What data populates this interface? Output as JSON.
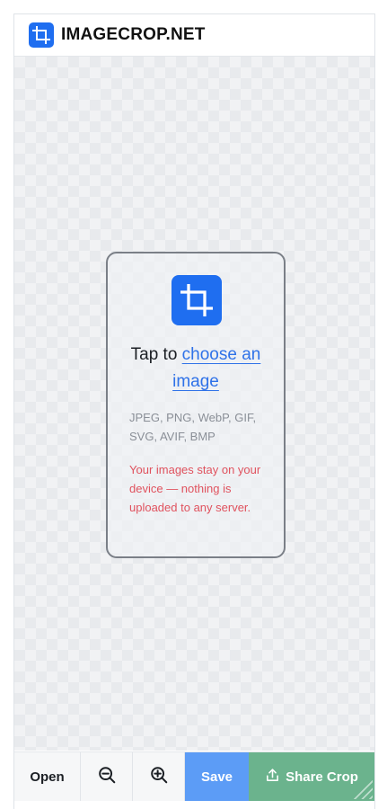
{
  "header": {
    "brand": "IMAGECROP.NET",
    "logo_icon": "crop-icon"
  },
  "dropzone": {
    "icon": "crop-icon",
    "prompt_prefix": "Tap to ",
    "prompt_link": "choose an image",
    "formats": "JPEG, PNG, WebP, GIF, SVG, AVIF, BMP",
    "privacy": "Your images stay on your device — nothing is uploaded to any server."
  },
  "toolbar": {
    "open_label": "Open",
    "zoom_out_icon": "zoom-out-icon",
    "zoom_in_icon": "zoom-in-icon",
    "save_label": "Save",
    "share_label": "Share Crop",
    "share_icon": "share-icon"
  },
  "colors": {
    "brand_blue": "#1f6ef0",
    "save_blue": "#5c9cf6",
    "share_green": "#6bb38d",
    "privacy_red": "#e0525e",
    "link_blue": "#2f72e8"
  }
}
